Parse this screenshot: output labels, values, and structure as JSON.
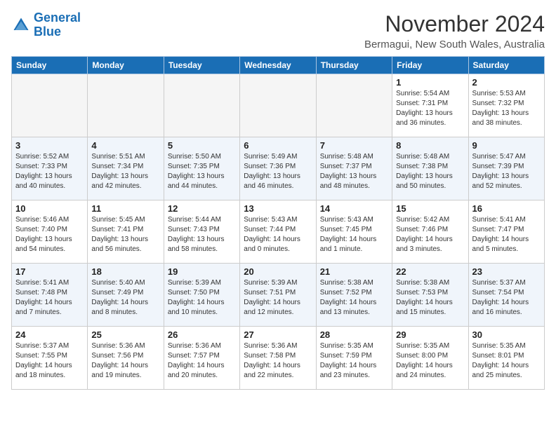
{
  "header": {
    "logo_line1": "General",
    "logo_line2": "Blue",
    "month_year": "November 2024",
    "location": "Bermagui, New South Wales, Australia"
  },
  "weekdays": [
    "Sunday",
    "Monday",
    "Tuesday",
    "Wednesday",
    "Thursday",
    "Friday",
    "Saturday"
  ],
  "weeks": [
    [
      {
        "day": "",
        "empty": true
      },
      {
        "day": "",
        "empty": true
      },
      {
        "day": "",
        "empty": true
      },
      {
        "day": "",
        "empty": true
      },
      {
        "day": "",
        "empty": true
      },
      {
        "day": "1",
        "sunrise": "Sunrise: 5:54 AM",
        "sunset": "Sunset: 7:31 PM",
        "daylight": "Daylight: 13 hours and 36 minutes."
      },
      {
        "day": "2",
        "sunrise": "Sunrise: 5:53 AM",
        "sunset": "Sunset: 7:32 PM",
        "daylight": "Daylight: 13 hours and 38 minutes."
      }
    ],
    [
      {
        "day": "3",
        "sunrise": "Sunrise: 5:52 AM",
        "sunset": "Sunset: 7:33 PM",
        "daylight": "Daylight: 13 hours and 40 minutes."
      },
      {
        "day": "4",
        "sunrise": "Sunrise: 5:51 AM",
        "sunset": "Sunset: 7:34 PM",
        "daylight": "Daylight: 13 hours and 42 minutes."
      },
      {
        "day": "5",
        "sunrise": "Sunrise: 5:50 AM",
        "sunset": "Sunset: 7:35 PM",
        "daylight": "Daylight: 13 hours and 44 minutes."
      },
      {
        "day": "6",
        "sunrise": "Sunrise: 5:49 AM",
        "sunset": "Sunset: 7:36 PM",
        "daylight": "Daylight: 13 hours and 46 minutes."
      },
      {
        "day": "7",
        "sunrise": "Sunrise: 5:48 AM",
        "sunset": "Sunset: 7:37 PM",
        "daylight": "Daylight: 13 hours and 48 minutes."
      },
      {
        "day": "8",
        "sunrise": "Sunrise: 5:48 AM",
        "sunset": "Sunset: 7:38 PM",
        "daylight": "Daylight: 13 hours and 50 minutes."
      },
      {
        "day": "9",
        "sunrise": "Sunrise: 5:47 AM",
        "sunset": "Sunset: 7:39 PM",
        "daylight": "Daylight: 13 hours and 52 minutes."
      }
    ],
    [
      {
        "day": "10",
        "sunrise": "Sunrise: 5:46 AM",
        "sunset": "Sunset: 7:40 PM",
        "daylight": "Daylight: 13 hours and 54 minutes."
      },
      {
        "day": "11",
        "sunrise": "Sunrise: 5:45 AM",
        "sunset": "Sunset: 7:41 PM",
        "daylight": "Daylight: 13 hours and 56 minutes."
      },
      {
        "day": "12",
        "sunrise": "Sunrise: 5:44 AM",
        "sunset": "Sunset: 7:43 PM",
        "daylight": "Daylight: 13 hours and 58 minutes."
      },
      {
        "day": "13",
        "sunrise": "Sunrise: 5:43 AM",
        "sunset": "Sunset: 7:44 PM",
        "daylight": "Daylight: 14 hours and 0 minutes."
      },
      {
        "day": "14",
        "sunrise": "Sunrise: 5:43 AM",
        "sunset": "Sunset: 7:45 PM",
        "daylight": "Daylight: 14 hours and 1 minute."
      },
      {
        "day": "15",
        "sunrise": "Sunrise: 5:42 AM",
        "sunset": "Sunset: 7:46 PM",
        "daylight": "Daylight: 14 hours and 3 minutes."
      },
      {
        "day": "16",
        "sunrise": "Sunrise: 5:41 AM",
        "sunset": "Sunset: 7:47 PM",
        "daylight": "Daylight: 14 hours and 5 minutes."
      }
    ],
    [
      {
        "day": "17",
        "sunrise": "Sunrise: 5:41 AM",
        "sunset": "Sunset: 7:48 PM",
        "daylight": "Daylight: 14 hours and 7 minutes."
      },
      {
        "day": "18",
        "sunrise": "Sunrise: 5:40 AM",
        "sunset": "Sunset: 7:49 PM",
        "daylight": "Daylight: 14 hours and 8 minutes."
      },
      {
        "day": "19",
        "sunrise": "Sunrise: 5:39 AM",
        "sunset": "Sunset: 7:50 PM",
        "daylight": "Daylight: 14 hours and 10 minutes."
      },
      {
        "day": "20",
        "sunrise": "Sunrise: 5:39 AM",
        "sunset": "Sunset: 7:51 PM",
        "daylight": "Daylight: 14 hours and 12 minutes."
      },
      {
        "day": "21",
        "sunrise": "Sunrise: 5:38 AM",
        "sunset": "Sunset: 7:52 PM",
        "daylight": "Daylight: 14 hours and 13 minutes."
      },
      {
        "day": "22",
        "sunrise": "Sunrise: 5:38 AM",
        "sunset": "Sunset: 7:53 PM",
        "daylight": "Daylight: 14 hours and 15 minutes."
      },
      {
        "day": "23",
        "sunrise": "Sunrise: 5:37 AM",
        "sunset": "Sunset: 7:54 PM",
        "daylight": "Daylight: 14 hours and 16 minutes."
      }
    ],
    [
      {
        "day": "24",
        "sunrise": "Sunrise: 5:37 AM",
        "sunset": "Sunset: 7:55 PM",
        "daylight": "Daylight: 14 hours and 18 minutes."
      },
      {
        "day": "25",
        "sunrise": "Sunrise: 5:36 AM",
        "sunset": "Sunset: 7:56 PM",
        "daylight": "Daylight: 14 hours and 19 minutes."
      },
      {
        "day": "26",
        "sunrise": "Sunrise: 5:36 AM",
        "sunset": "Sunset: 7:57 PM",
        "daylight": "Daylight: 14 hours and 20 minutes."
      },
      {
        "day": "27",
        "sunrise": "Sunrise: 5:36 AM",
        "sunset": "Sunset: 7:58 PM",
        "daylight": "Daylight: 14 hours and 22 minutes."
      },
      {
        "day": "28",
        "sunrise": "Sunrise: 5:35 AM",
        "sunset": "Sunset: 7:59 PM",
        "daylight": "Daylight: 14 hours and 23 minutes."
      },
      {
        "day": "29",
        "sunrise": "Sunrise: 5:35 AM",
        "sunset": "Sunset: 8:00 PM",
        "daylight": "Daylight: 14 hours and 24 minutes."
      },
      {
        "day": "30",
        "sunrise": "Sunrise: 5:35 AM",
        "sunset": "Sunset: 8:01 PM",
        "daylight": "Daylight: 14 hours and 25 minutes."
      }
    ]
  ]
}
